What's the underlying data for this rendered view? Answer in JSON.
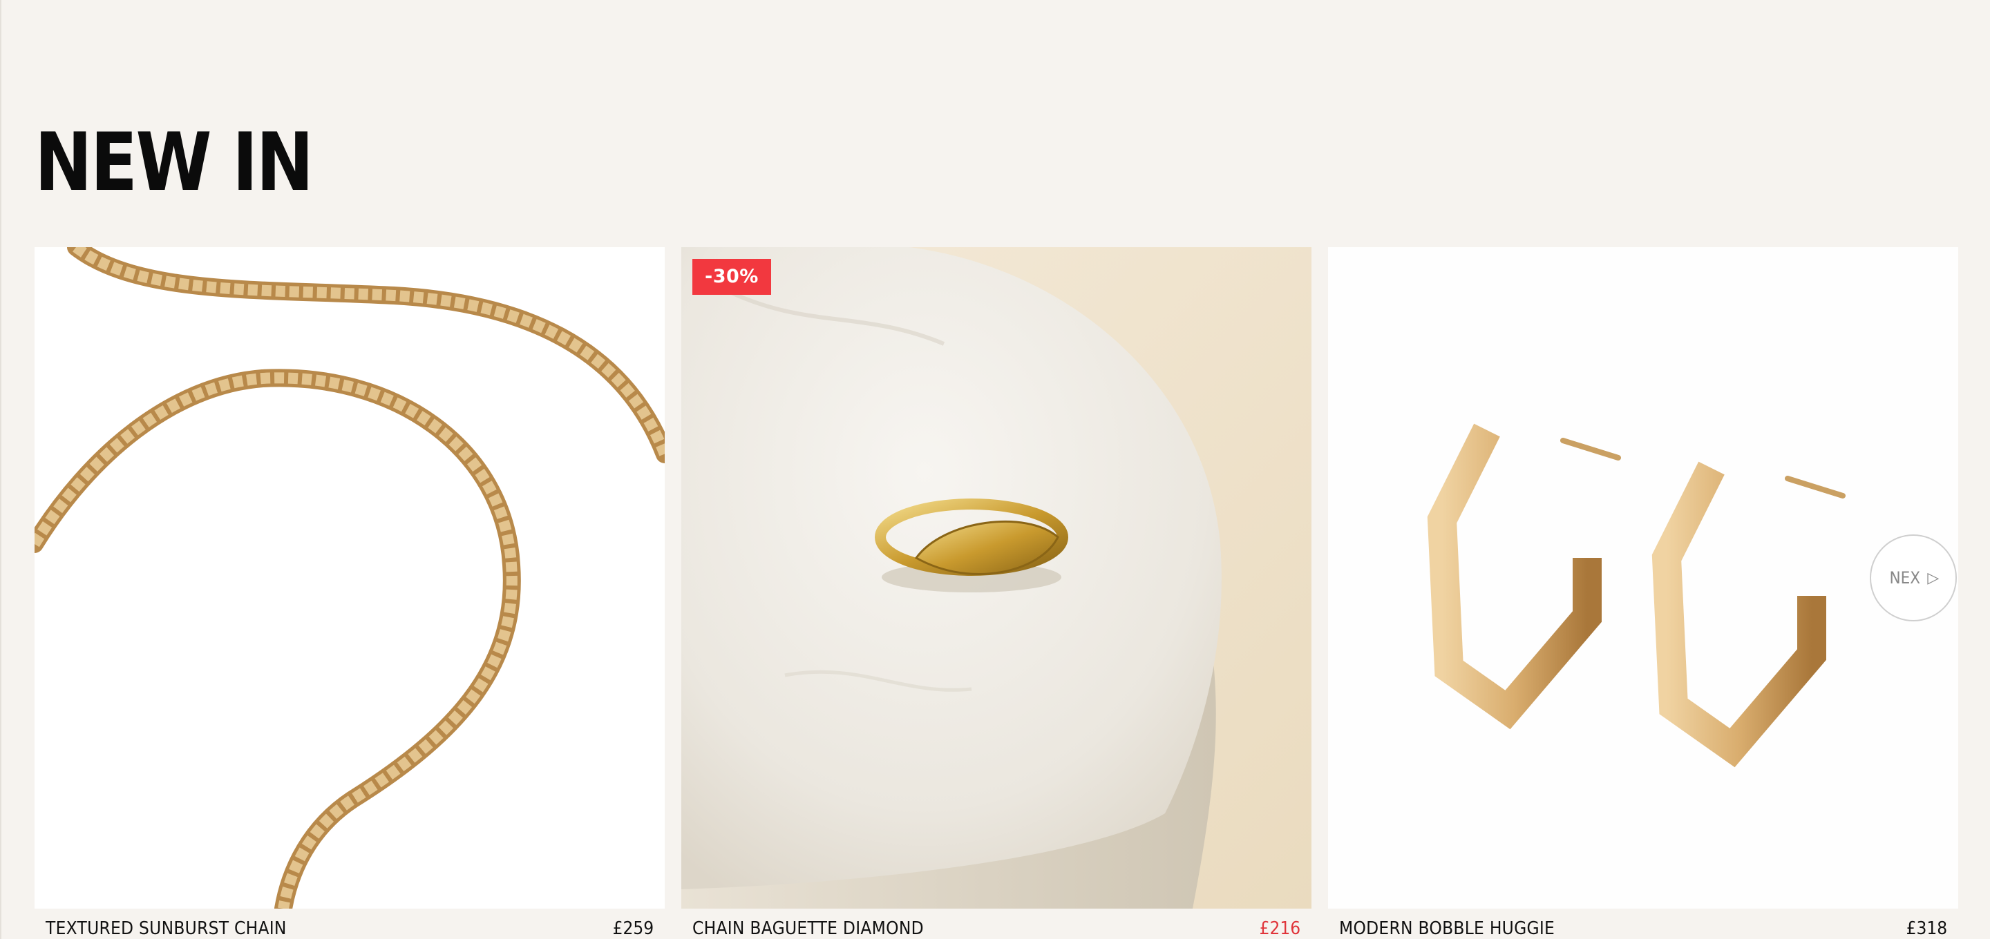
{
  "section": {
    "title": "NEW IN"
  },
  "products": [
    {
      "name": "TEXTURED SUNBURST CHAIN",
      "price": "£259",
      "image_icon": "gold-chain-necklace"
    },
    {
      "name": "CHAIN BAGUETTE DIAMOND",
      "price": "£216",
      "badge": "-30%",
      "image_icon": "gold-signet-ring"
    },
    {
      "name": "MODERN BOBBLE HUGGIE",
      "price": "£318",
      "image_icon": "gold-hexagon-hoop-earrings"
    }
  ],
  "carousel": {
    "next_label": "NEX",
    "next_icon": "play-arrow-icon",
    "next_glyph": "▷"
  },
  "colors": {
    "background": "#f6f3ef",
    "sale": "#e0353b",
    "badge": "#f2383f",
    "gold": "#c9a063"
  }
}
